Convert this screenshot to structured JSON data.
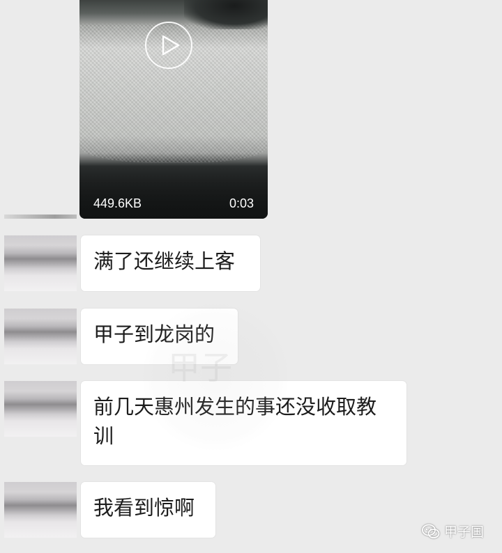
{
  "video_message": {
    "file_size": "449.6KB",
    "duration": "0:03",
    "play_icon": "play-icon"
  },
  "messages": [
    {
      "text": "满了还继续上客"
    },
    {
      "text": "甲子到龙岗的"
    },
    {
      "text": "前几天惠州发生的事还没收取教训"
    },
    {
      "text": "我看到惊啊"
    }
  ],
  "center_watermark": {
    "text": "甲子"
  },
  "corner_watermark": {
    "text": "甲子国",
    "icon": "wechat-icon"
  },
  "colors": {
    "background": "#ebebeb",
    "bubble": "#ffffff",
    "text": "#1c1c1c"
  }
}
